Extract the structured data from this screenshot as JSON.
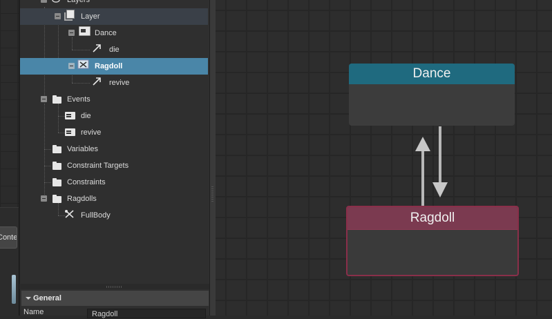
{
  "left_strip": {
    "tab_label": "Content"
  },
  "tree": {
    "rows": [
      {
        "label": "Layers"
      },
      {
        "label": "Layer"
      },
      {
        "label": "Dance"
      },
      {
        "label": "die"
      },
      {
        "label": "Ragdoll"
      },
      {
        "label": "revive"
      },
      {
        "label": "Events"
      },
      {
        "label": "die"
      },
      {
        "label": "revive"
      },
      {
        "label": "Variables"
      },
      {
        "label": "Constraint Targets"
      },
      {
        "label": "Constraints"
      },
      {
        "label": "Ragdolls"
      },
      {
        "label": "FullBody"
      }
    ]
  },
  "properties": {
    "section_title": "General",
    "name_label": "Name",
    "name_value": "Ragdoll"
  },
  "graph": {
    "nodes": [
      {
        "title": "Dance",
        "color": "#1f6a7f"
      },
      {
        "title": "Ragdoll",
        "color": "#7b3a50",
        "selected": true
      }
    ]
  },
  "colors": {
    "selection": "#4a86a8",
    "dance_header": "#1f6a7f",
    "ragdoll_header": "#7b3a50",
    "ragdoll_border": "#8a2f4a"
  }
}
